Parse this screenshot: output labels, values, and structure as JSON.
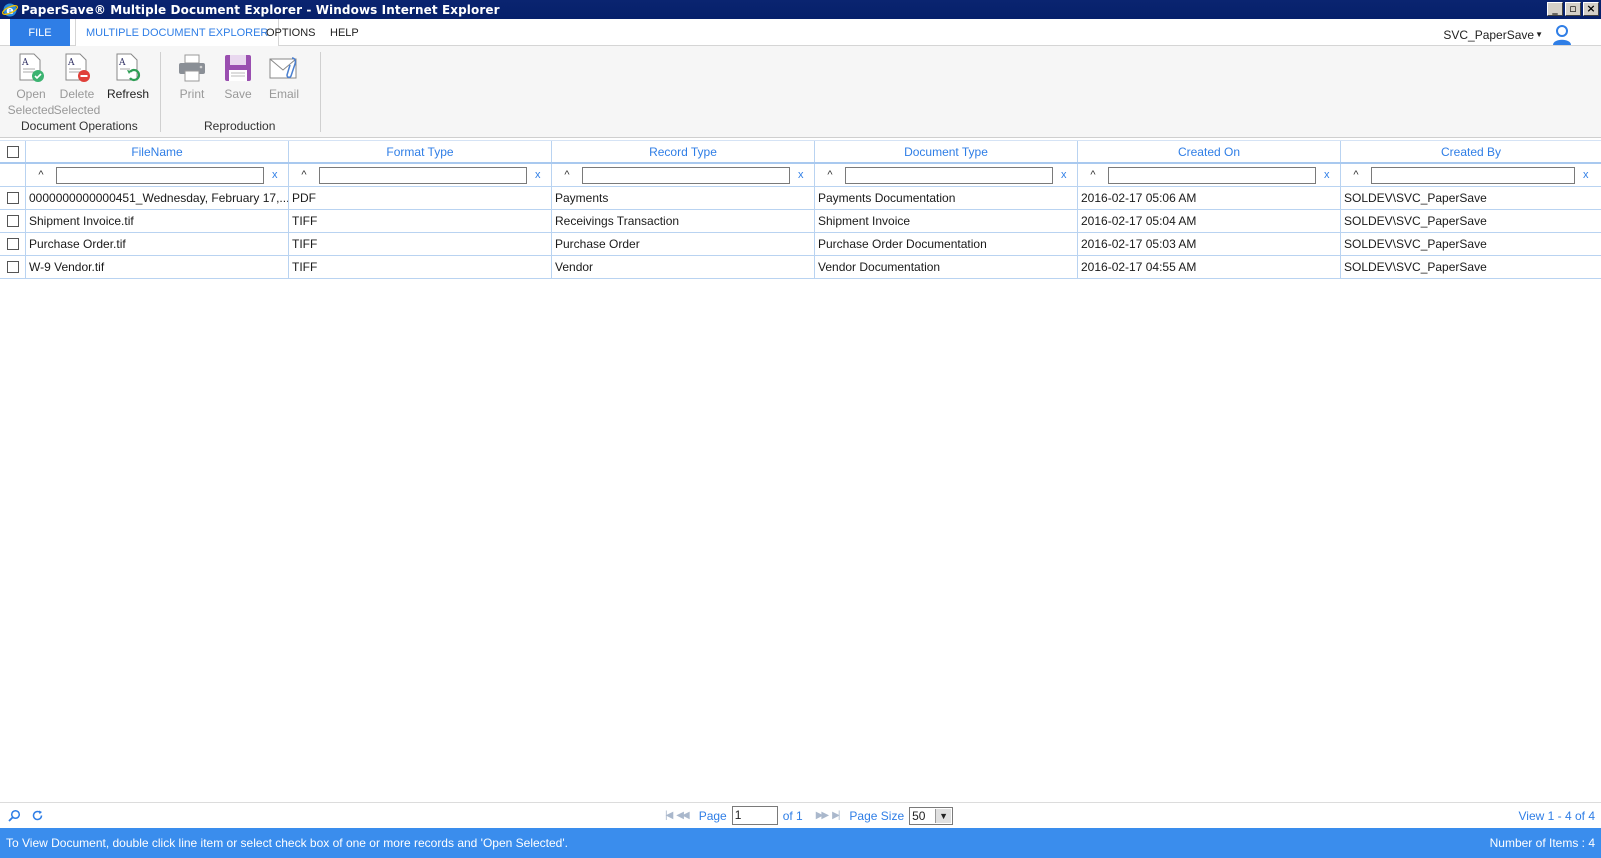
{
  "window": {
    "title": "PaperSave® Multiple Document Explorer - Windows Internet Explorer"
  },
  "menu": {
    "file_label": "FILE",
    "tabs": [
      "MULTIPLE DOCUMENT EXPLORER",
      "OPTIONS",
      "HELP"
    ],
    "user_name": "SVC_PaperSave"
  },
  "ribbon": {
    "groups": [
      {
        "label": "Document Operations",
        "buttons": [
          {
            "label_line1": "Open",
            "label_line2": "Selected",
            "enabled": false,
            "icon": "open-document-icon"
          },
          {
            "label_line1": "Delete",
            "label_line2": "Selected",
            "enabled": false,
            "icon": "delete-document-icon"
          },
          {
            "label_line1": "Refresh",
            "label_line2": "",
            "enabled": true,
            "icon": "refresh-document-icon"
          }
        ]
      },
      {
        "label": "Reproduction",
        "buttons": [
          {
            "label_line1": "Print",
            "enabled": false,
            "icon": "printer-icon"
          },
          {
            "label_line1": "Save",
            "enabled": false,
            "icon": "floppy-disk-icon"
          },
          {
            "label_line1": "Email",
            "enabled": false,
            "icon": "envelope-icon"
          }
        ]
      }
    ]
  },
  "grid": {
    "columns": [
      "FileName",
      "Format Type",
      "Record Type",
      "Document Type",
      "Created On",
      "Created By"
    ],
    "filter_caret": "^",
    "filter_clear": "x",
    "rows": [
      [
        "0000000000000451_Wednesday, February 17,...",
        "PDF",
        "Payments",
        "Payments Documentation",
        "2016-02-17 05:06 AM",
        "SOLDEV\\SVC_PaperSave"
      ],
      [
        "Shipment Invoice.tif",
        "TIFF",
        "Receivings Transaction",
        "Shipment Invoice",
        "2016-02-17 05:04 AM",
        "SOLDEV\\SVC_PaperSave"
      ],
      [
        "Purchase Order.tif",
        "TIFF",
        "Purchase Order",
        "Purchase Order Documentation",
        "2016-02-17 05:03 AM",
        "SOLDEV\\SVC_PaperSave"
      ],
      [
        "W-9 Vendor.tif",
        "TIFF",
        "Vendor",
        "Vendor Documentation",
        "2016-02-17 04:55 AM",
        "SOLDEV\\SVC_PaperSave"
      ]
    ]
  },
  "pager": {
    "page_label": "Page",
    "page_value": "1",
    "of_label": "of 1",
    "page_size_label": "Page Size",
    "page_size_value": "50",
    "view_text": "View 1 - 4 of 4"
  },
  "status": {
    "hint": "To View Document, double click line item or select check box of one or more records and 'Open Selected'.",
    "count": "Number of Items : 4"
  },
  "colors": {
    "accent": "#2f7ee6",
    "status_bar": "#3a8ded",
    "title_bar": "#0a2470",
    "grid_line": "#b9d3f1"
  }
}
